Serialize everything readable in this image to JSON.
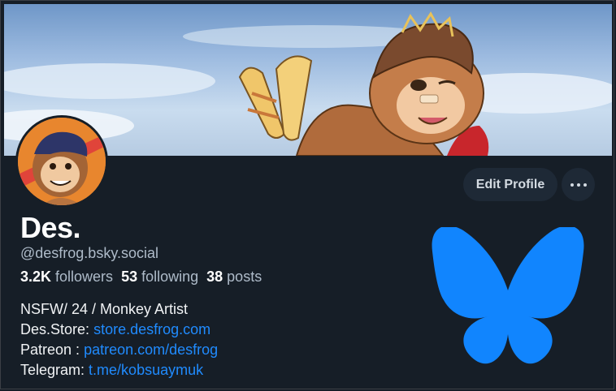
{
  "profile": {
    "display_name": "Des.",
    "handle": "@desfrog.bsky.social",
    "stats": {
      "followers_count": "3.2K",
      "followers_label": "followers",
      "following_count": "53",
      "following_label": "following",
      "posts_count": "38",
      "posts_label": "posts"
    },
    "bio": {
      "line1": "NSFW/ 24 / Monkey Artist",
      "store_label": "Des.Store:",
      "store_link": "store.desfrog.com",
      "patreon_label": "Patreon :",
      "patreon_link": "patreon.com/desfrog",
      "telegram_label": "Telegram:",
      "telegram_link": "t.me/kobsuaymuk"
    }
  },
  "actions": {
    "edit_profile_label": "Edit Profile",
    "more_icon": "ellipsis-icon"
  },
  "images": {
    "banner": "monkey-character-banner",
    "avatar": "monkey-character-avatar",
    "logo": "bluesky-butterfly-logo"
  },
  "colors": {
    "background": "#161e27",
    "link": "#208bfe",
    "button_bg": "#1e2936",
    "butterfly": "#1185fe"
  }
}
